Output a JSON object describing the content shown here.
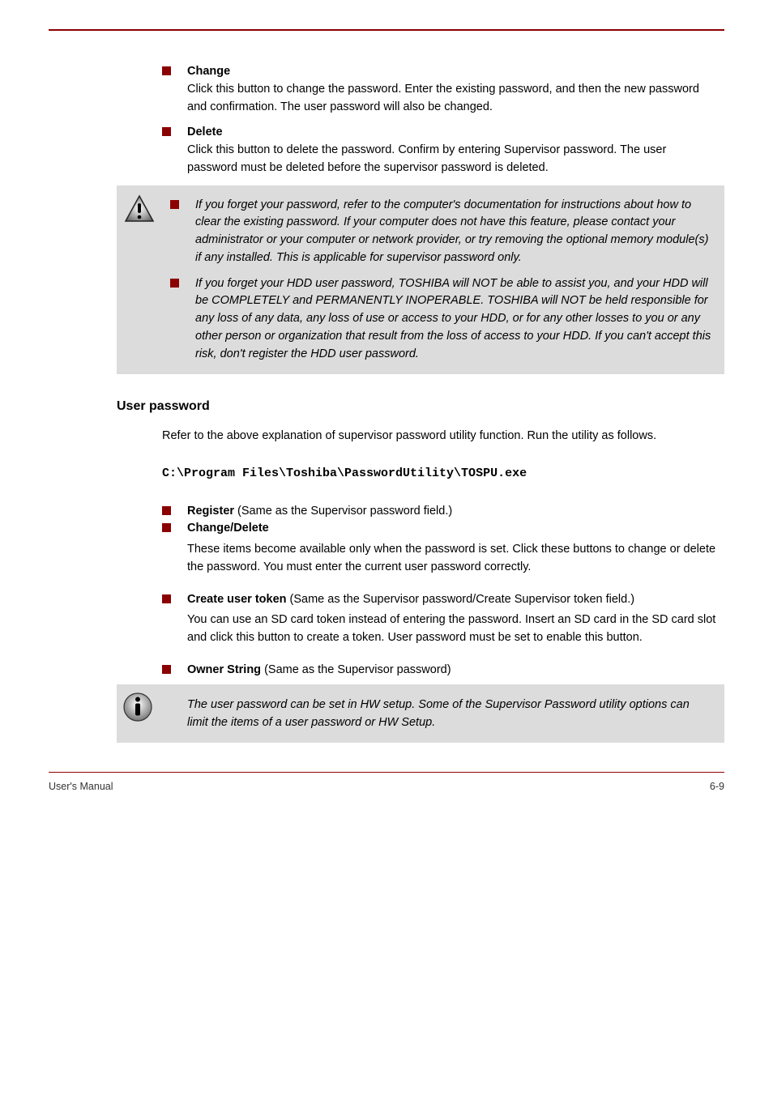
{
  "bullets_top": [
    {
      "label": "Change",
      "desc": "Click this button to change the password. Enter the existing password, and then the new password and confirmation. The user password will also be changed."
    },
    {
      "label": "Delete",
      "desc": "Click this button to delete the password. Confirm by entering Supervisor password. The user password must be deleted before the supervisor password is deleted."
    }
  ],
  "caution": [
    "If you forget your password, refer to the computer's documentation for instructions about how to clear the existing password. If your computer does not have this feature, please contact your administrator or your computer or network provider, or try removing the optional memory module(s) if any installed. This is applicable for supervisor password only.",
    "If you forget your HDD user password, TOSHIBA will NOT be able to assist you, and your HDD will be COMPLETELY and PERMANENTLY INOPERABLE. TOSHIBA will NOT be held responsible for any loss of any data, any loss of use or access to your HDD, or for any other losses to you or any other person or organization that result from the loss of access to your HDD. If you can't accept this risk, don't register the HDD user password."
  ],
  "section_title": "User password",
  "section_intro": "Refer to the above explanation of supervisor password utility function. Run the utility as follows.",
  "exe_path": "C:\\Program Files\\Toshiba\\PasswordUtility\\TOSPU.exe",
  "user_bullets": [
    {
      "label": "Register",
      "rest": " (Same as the Supervisor password field.)"
    },
    {
      "label": "Change/Delete",
      "rest": ""
    }
  ],
  "user_change_delete": "These items become available only when the password is set. Click these buttons to change or delete the password. You must enter the current user password correctly.",
  "create_token": {
    "label": "Create user token",
    "rest": " (Same as the Supervisor password/Create Supervisor token field.)",
    "extra": "You can use an SD card token instead of entering the password. Insert an SD card in the SD card slot and click this button to create a token. User password must be set to enable this button."
  },
  "owner_line": {
    "label": "Owner String",
    "rest": " (Same as the Supervisor password)"
  },
  "info_note": "The user password can be set in HW setup. Some of the Supervisor Password utility options can limit the items of a user password or HW Setup.",
  "footer": {
    "left": "User's Manual",
    "right": "6-9"
  }
}
